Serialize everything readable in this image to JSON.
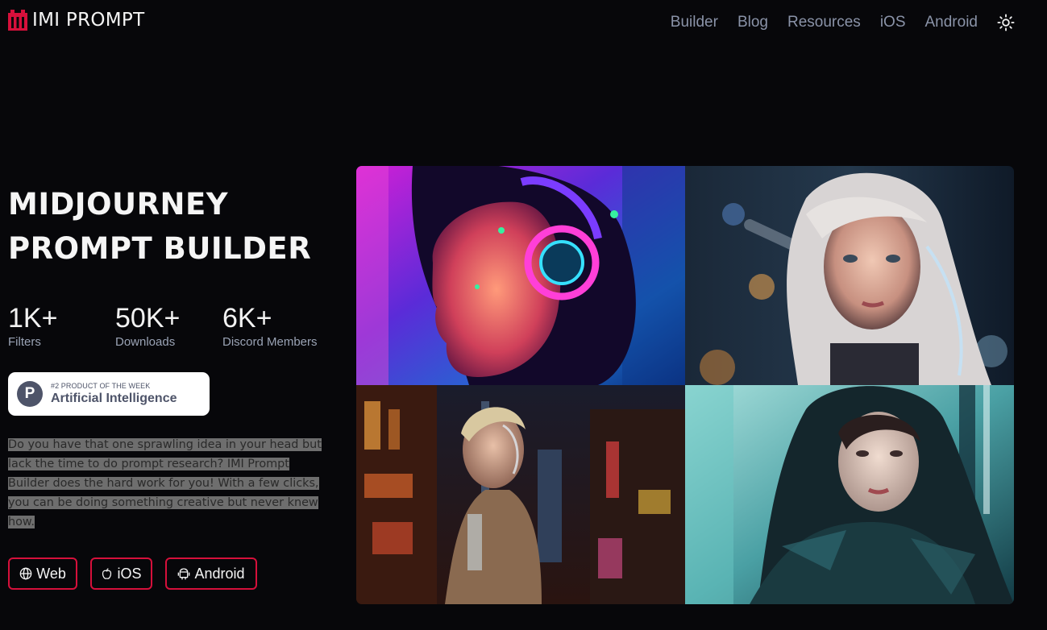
{
  "header": {
    "brand": "IMI PROMPT",
    "nav": [
      "Builder",
      "Blog",
      "Resources",
      "iOS",
      "Android"
    ],
    "theme_icon": "sun-icon"
  },
  "hero": {
    "title_line1": "MIDJOURNEY",
    "title_line2": "PROMPT BUILDER",
    "stats": [
      {
        "value": "1K+",
        "label": "Filters"
      },
      {
        "value": "50K+",
        "label": "Downloads"
      },
      {
        "value": "6K+",
        "label": "Discord Members"
      }
    ],
    "badge": {
      "small": "#2 PRODUCT OF THE WEEK",
      "big": "Artificial Intelligence",
      "letter": "P"
    },
    "description": "Do you have that one sprawling idea in your head but lack the time to do prompt research? IMI Prompt Builder does the hard work for you! With a few clicks, you can be doing something creative but never knew how.",
    "buttons": [
      {
        "label": "Web",
        "icon": "globe-icon"
      },
      {
        "label": "iOS",
        "icon": "apple-icon"
      },
      {
        "label": "Android",
        "icon": "android-icon"
      }
    ]
  },
  "gallery": {
    "images": [
      {
        "name": "neon-headphones-girl"
      },
      {
        "name": "silver-hair-woman"
      },
      {
        "name": "cyborg-woman-city"
      },
      {
        "name": "hooded-girl-teal"
      }
    ]
  },
  "colors": {
    "background": "#07070a",
    "accent": "#d6103b",
    "nav_text": "#8a93a8",
    "badge_text": "#4e5469"
  }
}
